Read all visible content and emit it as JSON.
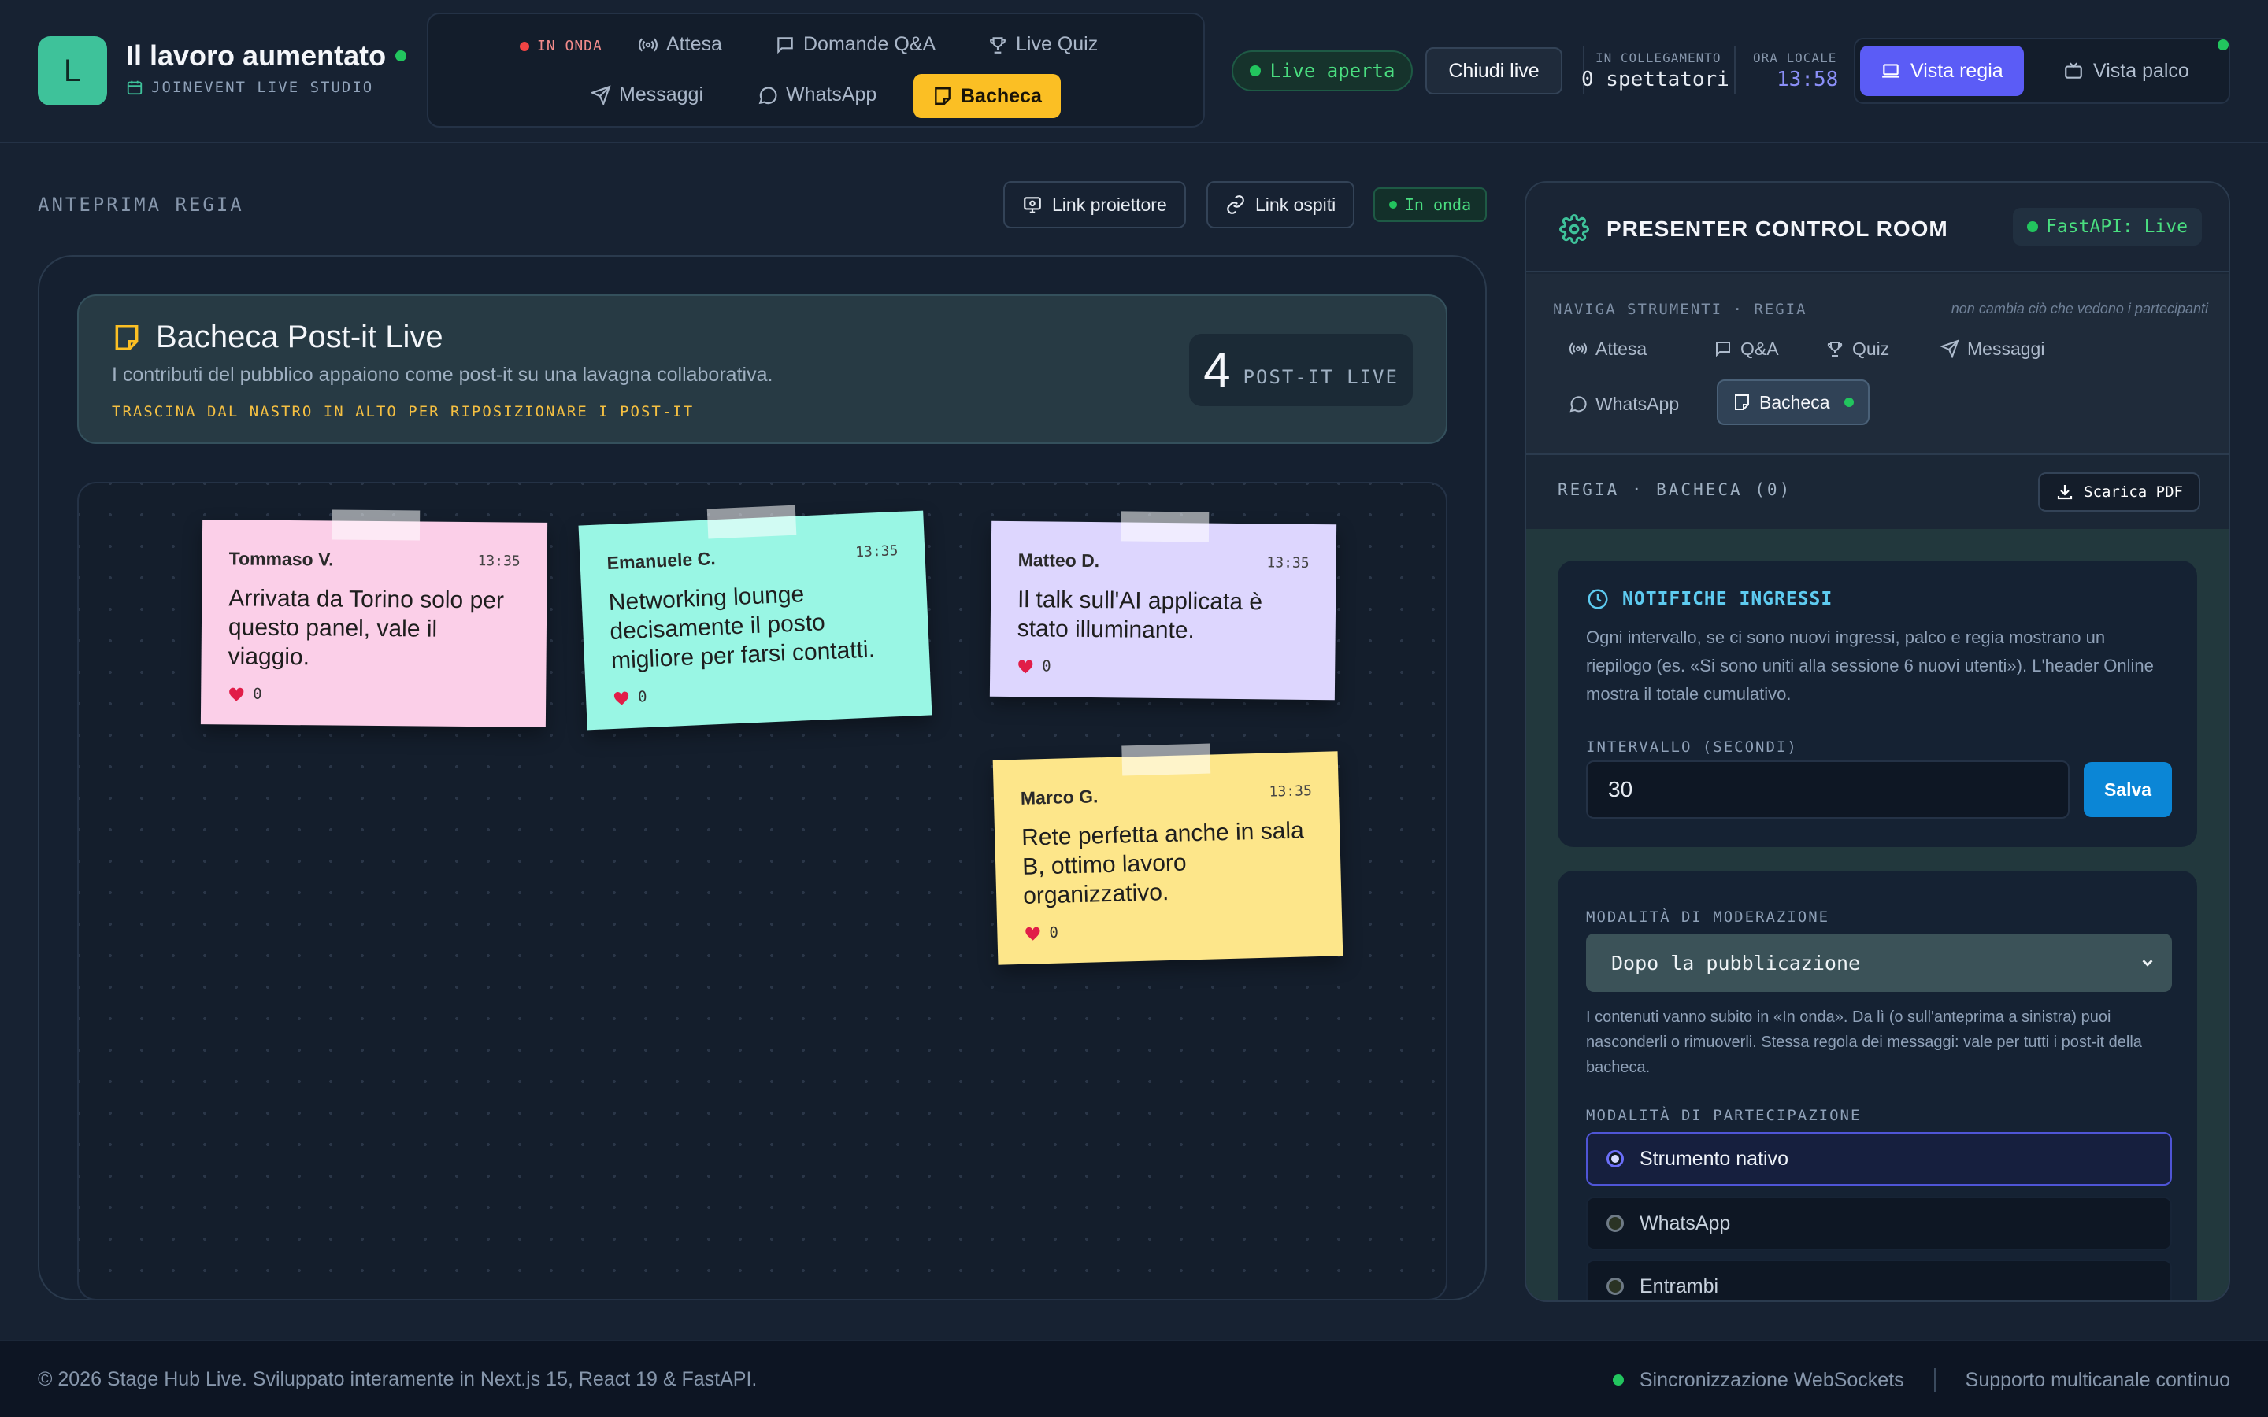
{
  "header": {
    "logo_letter": "L",
    "title": "Il lavoro aumentato",
    "subtitle": "JOINEVENT LIVE STUDIO",
    "nav": {
      "live_label": "IN ONDA",
      "items": [
        "Attesa",
        "Domande Q&A",
        "Live Quiz",
        "Messaggi",
        "WhatsApp",
        "Bacheca"
      ],
      "active": "Bacheca"
    },
    "live_status": "Live aperta",
    "close_live": "Chiudi live",
    "connected_label": "IN COLLEGAMENTO",
    "connected_value": "0 spettatori",
    "time_label": "ORA LOCALE",
    "time_value": "13:58",
    "view_regia": "Vista regia",
    "view_palco": "Vista palco"
  },
  "preview": {
    "label": "ANTEPRIMA REGIA",
    "projector_link": "Link proiettore",
    "guest_link": "Link ospiti",
    "on_air_tag": "In onda"
  },
  "board": {
    "title": "Bacheca Post-it Live",
    "description": "I contributi del pubblico appaiono come post-it su una lavagna collaborativa.",
    "hint": "TRASCINA DAL NASTRO IN ALTO PER RIPOSIZIONARE I POST-IT",
    "count": "4",
    "count_label": "POST-IT LIVE",
    "notes": [
      {
        "author": "Tommaso V.",
        "time": "13:35",
        "text": "Arrivata da Torino solo per questo panel, vale il viaggio.",
        "likes": "0",
        "color": "#fbcfe8"
      },
      {
        "author": "Emanuele C.",
        "time": "13:35",
        "text": "Networking lounge decisamente il posto migliore per farsi contatti.",
        "likes": "0",
        "color": "#99f6e4"
      },
      {
        "author": "Matteo D.",
        "time": "13:35",
        "text": "Il talk sull'AI applicata è stato illuminante.",
        "likes": "0",
        "color": "#ddd6fe"
      },
      {
        "author": "Marco G.",
        "time": "13:35",
        "text": "Rete perfetta anche in sala B, ottimo lavoro organizzativo.",
        "likes": "0",
        "color": "#fde68a"
      }
    ]
  },
  "panel": {
    "title": "PRESENTER CONTROL ROOM",
    "api_status": "FastAPI: Live",
    "nav_label": "NAVIGA STRUMENTI · REGIA",
    "nav_note": "non cambia ciò che vedono i partecipanti",
    "tools": [
      "Attesa",
      "Q&A",
      "Quiz",
      "Messaggi",
      "WhatsApp",
      "Bacheca"
    ],
    "section_label": "REGIA · BACHECA (0)",
    "download_pdf": "Scarica PDF",
    "notifications": {
      "title": "NOTIFICHE INGRESSI",
      "text": "Ogni intervallo, se ci sono nuovi ingressi, palco e regia mostrano un riepilogo (es. «Si sono uniti alla sessione 6 nuovi utenti»). L'header Online mostra il totale cumulativo.",
      "interval_label": "INTERVALLO (SECONDI)",
      "interval_value": "30",
      "save": "Salva"
    },
    "moderation": {
      "label": "MODALITÀ DI MODERAZIONE",
      "selected": "Dopo la pubblicazione",
      "text": "I contenuti vanno subito in «In onda». Da lì (o sull'anteprima a sinistra) puoi nasconderli o rimuoverli. Stessa regola dei messaggi: vale per tutti i post-it della bacheca."
    },
    "participation": {
      "label": "MODALITÀ DI PARTECIPAZIONE",
      "options": [
        "Strumento nativo",
        "WhatsApp",
        "Entrambi"
      ],
      "selected": "Strumento nativo"
    }
  },
  "footer": {
    "copyright": "© 2026 Stage Hub Live. Sviluppato interamente in Next.js 15, React 19 & FastAPI.",
    "sync": "Sincronizzazione WebSockets",
    "support": "Supporto multicanale continuo"
  },
  "colors": {
    "accent_purple": "#5b5cf6",
    "accent_yellow": "#fbbf24",
    "live_green": "#22c55e",
    "save_blue": "#0b86d6"
  }
}
